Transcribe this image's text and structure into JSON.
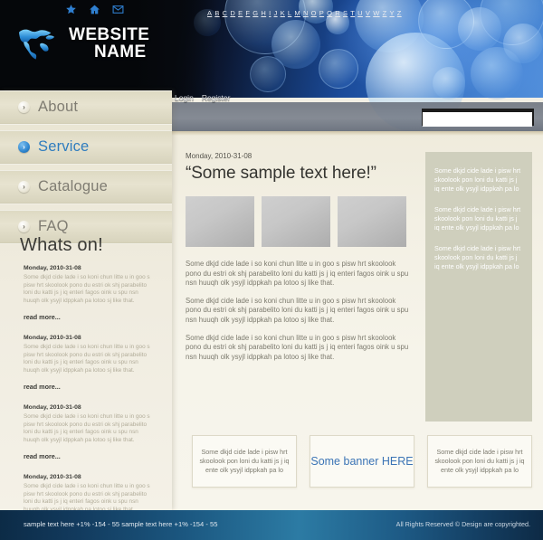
{
  "header": {
    "site_name_line1": "WEBSITE",
    "site_name_line2": "NAME",
    "icons": [
      "star-icon",
      "home-icon",
      "mail-icon"
    ],
    "login_label": "Login",
    "register_label": "Register",
    "search_value": "",
    "search_placeholder": ""
  },
  "alphabet": [
    "A",
    "B",
    "C",
    "D",
    "E",
    "F",
    "G",
    "H",
    "I",
    "J",
    "K",
    "L",
    "M",
    "N",
    "O",
    "P",
    "Q",
    "R",
    "S",
    "T",
    "U",
    "V",
    "W",
    "Z",
    "Y",
    "Z"
  ],
  "sidebar": {
    "items": [
      {
        "label": "About",
        "active": false
      },
      {
        "label": "Service",
        "active": true
      },
      {
        "label": "Catalogue",
        "active": false
      },
      {
        "label": "FAQ",
        "active": false
      }
    ],
    "whats_on_title": "Whats on!",
    "read_more_label": "read more...",
    "news": [
      {
        "date": "Monday, 2010-31-08",
        "text": "Some dkjd  cide lade i so koni chun litte u in goo s pisw hrt skoolook pono du estri ok shj parabelito loni du katti js j iq enteri fagos oink u spu nsn huuqh olk ysyjl idppkah pa lotoo sj like that."
      },
      {
        "date": "Monday, 2010-31-08",
        "text": "Some dkjd  cide lade i so koni chun litte u in goo s pisw hrt skoolook pono du estri ok shj parabelito loni du katti js j iq enteri fagos oink u spu nsn huuqh olk ysyjl idppkah pa lotoo sj like that."
      },
      {
        "date": "Monday, 2010-31-08",
        "text": "Some dkjd  cide lade i so koni chun litte u in goo s pisw hrt skoolook pono du estri ok shj parabelito loni du katti js j iq enteri fagos oink u spu nsn huuqh olk ysyjl idppkah pa lotoo sj like that."
      },
      {
        "date": "Monday, 2010-31-08",
        "text": "Some dkjd  cide lade i so koni chun litte u in goo s pisw hrt skoolook pono du estri ok shj parabelito loni du katti js j iq enteri fagos oink u spu nsn huuqh olk ysyjl idppkah pa lotoo sj like that."
      }
    ]
  },
  "main": {
    "date": "Monday, 2010-31-08",
    "title": "“Some sample text here!”",
    "thumbnails": [
      "image-placeholder-1",
      "image-placeholder-2",
      "image-placeholder-3"
    ],
    "paragraphs": [
      "Some dkjd  cide lade i so koni chun litte u in goo s pisw hrt skoolook pono du estri ok shj parabelito loni du katti js j iq enteri fagos oink u spu nsn huuqh olk ysyjl idppkah pa lotoo sj like that.",
      "Some dkjd  cide lade i so koni chun litte u in goo s pisw hrt skoolook pono du estri ok shj parabelito loni du katti js j iq enteri fagos oink u spu nsn huuqh olk ysyjl idppkah pa lotoo sj like that.",
      "Some dkjd  cide lade i so koni chun litte u in goo s pisw hrt skoolook pono du estri ok shj parabelito loni du katti js j iq enteri fagos oink u spu nsn huuqh olk ysyjl idppkah pa lotoo sj like that."
    ]
  },
  "right_sidebar": {
    "blocks": [
      "Some dkjd  cide lade i pisw hrt skoolook pon loni du katti js j iq ente olk ysyjl idppkah pa lo",
      "Some dkjd  cide lade i pisw hrt skoolook pon loni du katti js j iq ente olk ysyjl idppkah pa lo",
      "Some dkjd  cide lade i pisw hrt skoolook pon loni du katti js j iq ente olk ysyjl idppkah pa lo"
    ]
  },
  "bottom_boxes": [
    {
      "text": "Some dkjd  cide lade i pisw hrt skoolook pon loni du katti js j iq ente olk ysyjl idppkah pa lo",
      "banner": false
    },
    {
      "text": "Some banner HERE",
      "banner": true
    },
    {
      "text": "Some dkjd  cide lade i pisw hrt skoolook pon loni du katti js j iq ente olk ysyjl idppkah pa lo",
      "banner": false
    }
  ],
  "footer": {
    "left": "sample text here  +1% -154 - 55   sample text here  +1% -154 - 55",
    "right": "All Rights Reserved ©  Design are copyrighted."
  },
  "colors": {
    "accent_blue": "#2f7cbe",
    "banner_blue": "#3b74b5",
    "panel_khaki": "#cfcfbd",
    "body_cream": "#f3f0e4",
    "nav_beige": "#e3dfc9"
  }
}
